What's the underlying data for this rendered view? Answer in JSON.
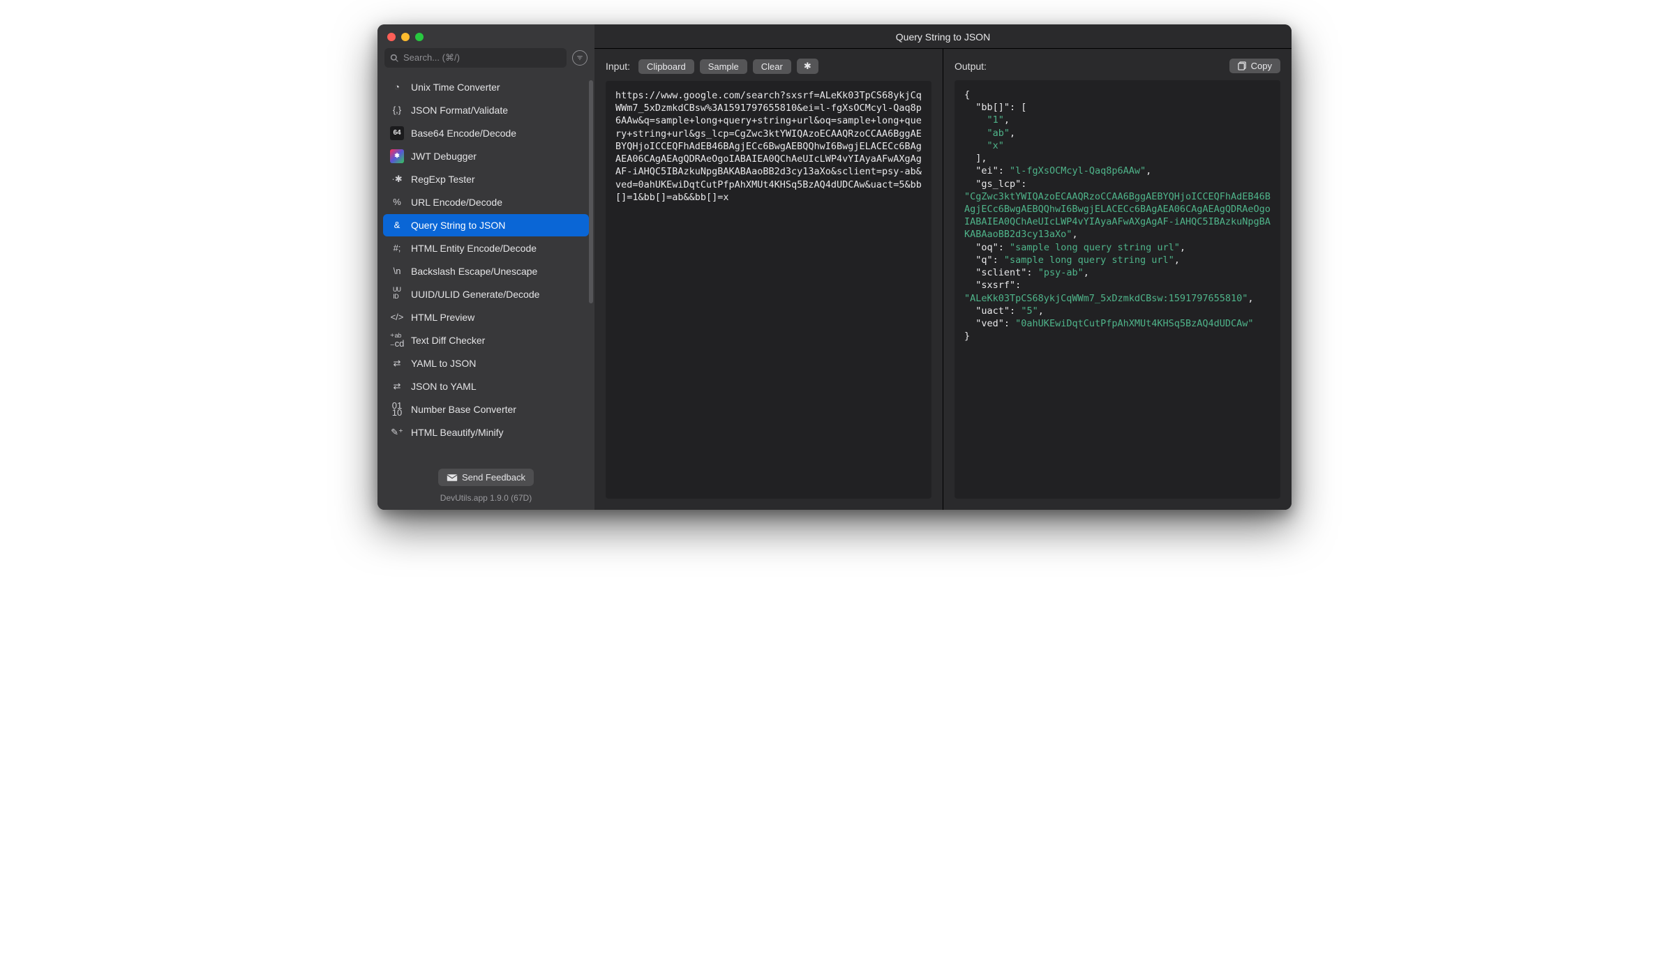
{
  "title": "Query String to JSON",
  "search": {
    "placeholder": "Search... (⌘/)"
  },
  "sidebar": {
    "items": [
      {
        "label": "Unix Time Converter",
        "icon": "clock"
      },
      {
        "label": "JSON Format/Validate",
        "icon": "braces"
      },
      {
        "label": "Base64 Encode/Decode",
        "icon": "b64"
      },
      {
        "label": "JWT Debugger",
        "icon": "jwt"
      },
      {
        "label": "RegExp Tester",
        "icon": "regex"
      },
      {
        "label": "URL Encode/Decode",
        "icon": "percent"
      },
      {
        "label": "Query String to JSON",
        "icon": "amp",
        "active": true
      },
      {
        "label": "HTML Entity Encode/Decode",
        "icon": "hash"
      },
      {
        "label": "Backslash Escape/Unescape",
        "icon": "backslash"
      },
      {
        "label": "UUID/ULID Generate/Decode",
        "icon": "uuid"
      },
      {
        "label": "HTML Preview",
        "icon": "code"
      },
      {
        "label": "Text Diff Checker",
        "icon": "diff"
      },
      {
        "label": "YAML to JSON",
        "icon": "swap"
      },
      {
        "label": "JSON to YAML",
        "icon": "swap"
      },
      {
        "label": "Number Base Converter",
        "icon": "bits"
      },
      {
        "label": "HTML Beautify/Minify",
        "icon": "wand"
      }
    ],
    "feedback_label": "Send Feedback",
    "version": "DevUtils.app 1.9.0 (67D)"
  },
  "input": {
    "label": "Input:",
    "buttons": {
      "clipboard": "Clipboard",
      "sample": "Sample",
      "clear": "Clear"
    },
    "text": "https://www.google.com/search?sxsrf=ALeKk03TpCS68ykjCqWWm7_5xDzmkdCBsw%3A1591797655810&ei=l-fgXsOCMcyl-Qaq8p6AAw&q=sample+long+query+string+url&oq=sample+long+query+string+url&gs_lcp=CgZwc3ktYWIQAzoECAAQRzoCCAA6BggAEBYQHjoICCEQFhAdEB46BAgjECc6BwgAEBQQhwI6BwgjELACECc6BAgAEA06CAgAEAgQDRAeOgoIABAIEA0QChAeUIcLWP4vYIAyaAFwAXgAgAF-iAHQC5IBAzkuNpgBAKABAaoBB2d3cy13aXo&sclient=psy-ab&ved=0ahUKEwiDqtCutPfpAhXMUt4KHSq5BzAQ4dUDCAw&uact=5&bb[]=1&bb[]=ab&&bb[]=x"
  },
  "output": {
    "label": "Output:",
    "copy_label": "Copy",
    "json": {
      "bb[]": [
        "1",
        "ab",
        "x"
      ],
      "ei": "l-fgXsOCMcyl-Qaq8p6AAw",
      "gs_lcp": "CgZwc3ktYWIQAzoECAAQRzoCCAA6BggAEBYQHjoICCEQFhAdEB46BAgjECc6BwgAEBQQhwI6BwgjELACECc6BAgAEA06CAgAEAgQDRAeOgoIABAIEA0QChAeUIcLWP4vYIAyaAFwAXgAgAF-iAHQC5IBAzkuNpgBAKABAaoBB2d3cy13aXo",
      "oq": "sample long query string url",
      "q": "sample long query string url",
      "sclient": "psy-ab",
      "sxsrf": "ALeKk03TpCS68ykjCqWWm7_5xDzmkdCBsw:1591797655810",
      "uact": "5",
      "ved": "0ahUKEwiDqtCutPfpAhXMUt4KHSq5BzAQ4dUDCAw"
    }
  }
}
